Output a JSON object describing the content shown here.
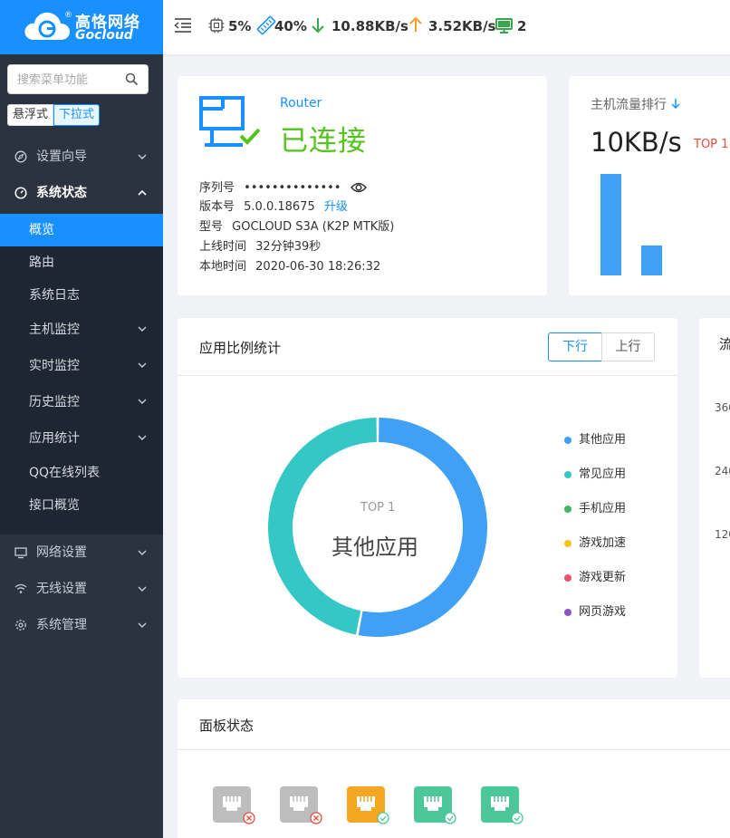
{
  "brand": {
    "name_cn": "高恪网络",
    "name_en": "Gocloud",
    "reg_mark": "®"
  },
  "sidebar": {
    "search_placeholder": "搜索菜单功能",
    "menu_mode": {
      "float": "悬浮式",
      "dropdown": "下拉式"
    },
    "items": [
      {
        "label": "设置向导",
        "icon": "compass-icon"
      },
      {
        "label": "系统状态",
        "icon": "dashboard-icon"
      },
      {
        "label": "网络设置",
        "icon": "monitor-icon"
      },
      {
        "label": "无线设置",
        "icon": "wifi-icon"
      },
      {
        "label": "系统管理",
        "icon": "gear-icon"
      }
    ],
    "sub_items": [
      {
        "label": "概览"
      },
      {
        "label": "路由"
      },
      {
        "label": "系统日志"
      },
      {
        "label": "主机监控"
      },
      {
        "label": "实时监控"
      },
      {
        "label": "历史监控"
      },
      {
        "label": "应用统计"
      },
      {
        "label": "QQ在线列表"
      },
      {
        "label": "接口概览"
      }
    ]
  },
  "topbar": {
    "cpu": "5%",
    "memory": "40%",
    "download": "10.88KB/s",
    "upload": "3.52KB/s",
    "hosts": "2"
  },
  "router": {
    "label": "Router",
    "status": "已连接",
    "serial_label": "序列号",
    "serial_value": "••••••••••••••",
    "version_label": "版本号",
    "version_value": "5.0.0.18675",
    "upgrade": "升级",
    "model_label": "型号",
    "model_value": "GOCLOUD S3A (K2P MTK版)",
    "uptime_label": "上线时间",
    "uptime_value": "32分钟39秒",
    "localtime_label": "本地时间",
    "localtime_value": "2020-06-30 18:26:32"
  },
  "rank": {
    "title": "主机流量排行",
    "value": "10KB/s",
    "top_label": "TOP 1"
  },
  "app_stats": {
    "title": "应用比例统计",
    "tab_down": "下行",
    "tab_up": "上行",
    "center_top": "TOP 1",
    "center_name": "其他应用",
    "legend": [
      {
        "name": "其他应用",
        "color": "#3fa0f5"
      },
      {
        "name": "常见应用",
        "color": "#34c7c6"
      },
      {
        "name": "手机应用",
        "color": "#3fb964"
      },
      {
        "name": "游戏加速",
        "color": "#f3c21c"
      },
      {
        "name": "游戏更新",
        "color": "#e9536f"
      },
      {
        "name": "网页游戏",
        "color": "#8c51c9"
      }
    ]
  },
  "chart_data": {
    "type": "pie",
    "categories": [
      "其他应用",
      "常见应用"
    ],
    "values": [
      53,
      47
    ]
  },
  "flow_card": {
    "title": "流",
    "ticks": [
      "360",
      "240",
      "120"
    ]
  },
  "panel": {
    "title": "面板状态"
  },
  "colors": {
    "primary": "#1890ff",
    "success": "#52c41a",
    "sidebar": "#2b3341",
    "orange": "#f5a623",
    "green_port": "#4cc79a",
    "gray_port": "#bdbdbd"
  }
}
